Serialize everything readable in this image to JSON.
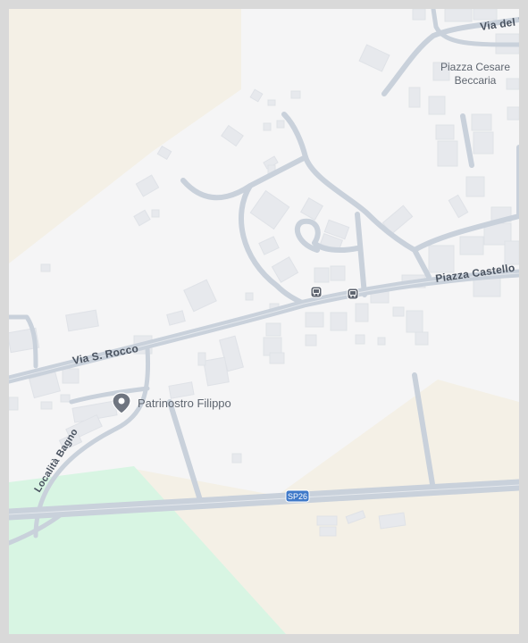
{
  "map": {
    "roads": {
      "via_s_rocco": "Via S. Rocco",
      "piazza_castello": "Piazza Castello",
      "via_del": "Via del I",
      "localita_bagno": "Località Bagno"
    },
    "places": {
      "piazza_line1": "Piazza Cesare",
      "piazza_line2": "Beccaria"
    },
    "poi": {
      "label": "Patrinostro Filippo",
      "icon": "map-pin-icon"
    },
    "route_shield": "SP26",
    "transit_icons": [
      "bus-stop-icon",
      "bus-stop-icon"
    ],
    "colors": {
      "background": "#f5f5f6",
      "road": "#c9d1db",
      "building": "#e7e9ed",
      "green_area": "#d8f5e3",
      "field": "#f4f0e6",
      "shield": "#3f79c9"
    }
  }
}
